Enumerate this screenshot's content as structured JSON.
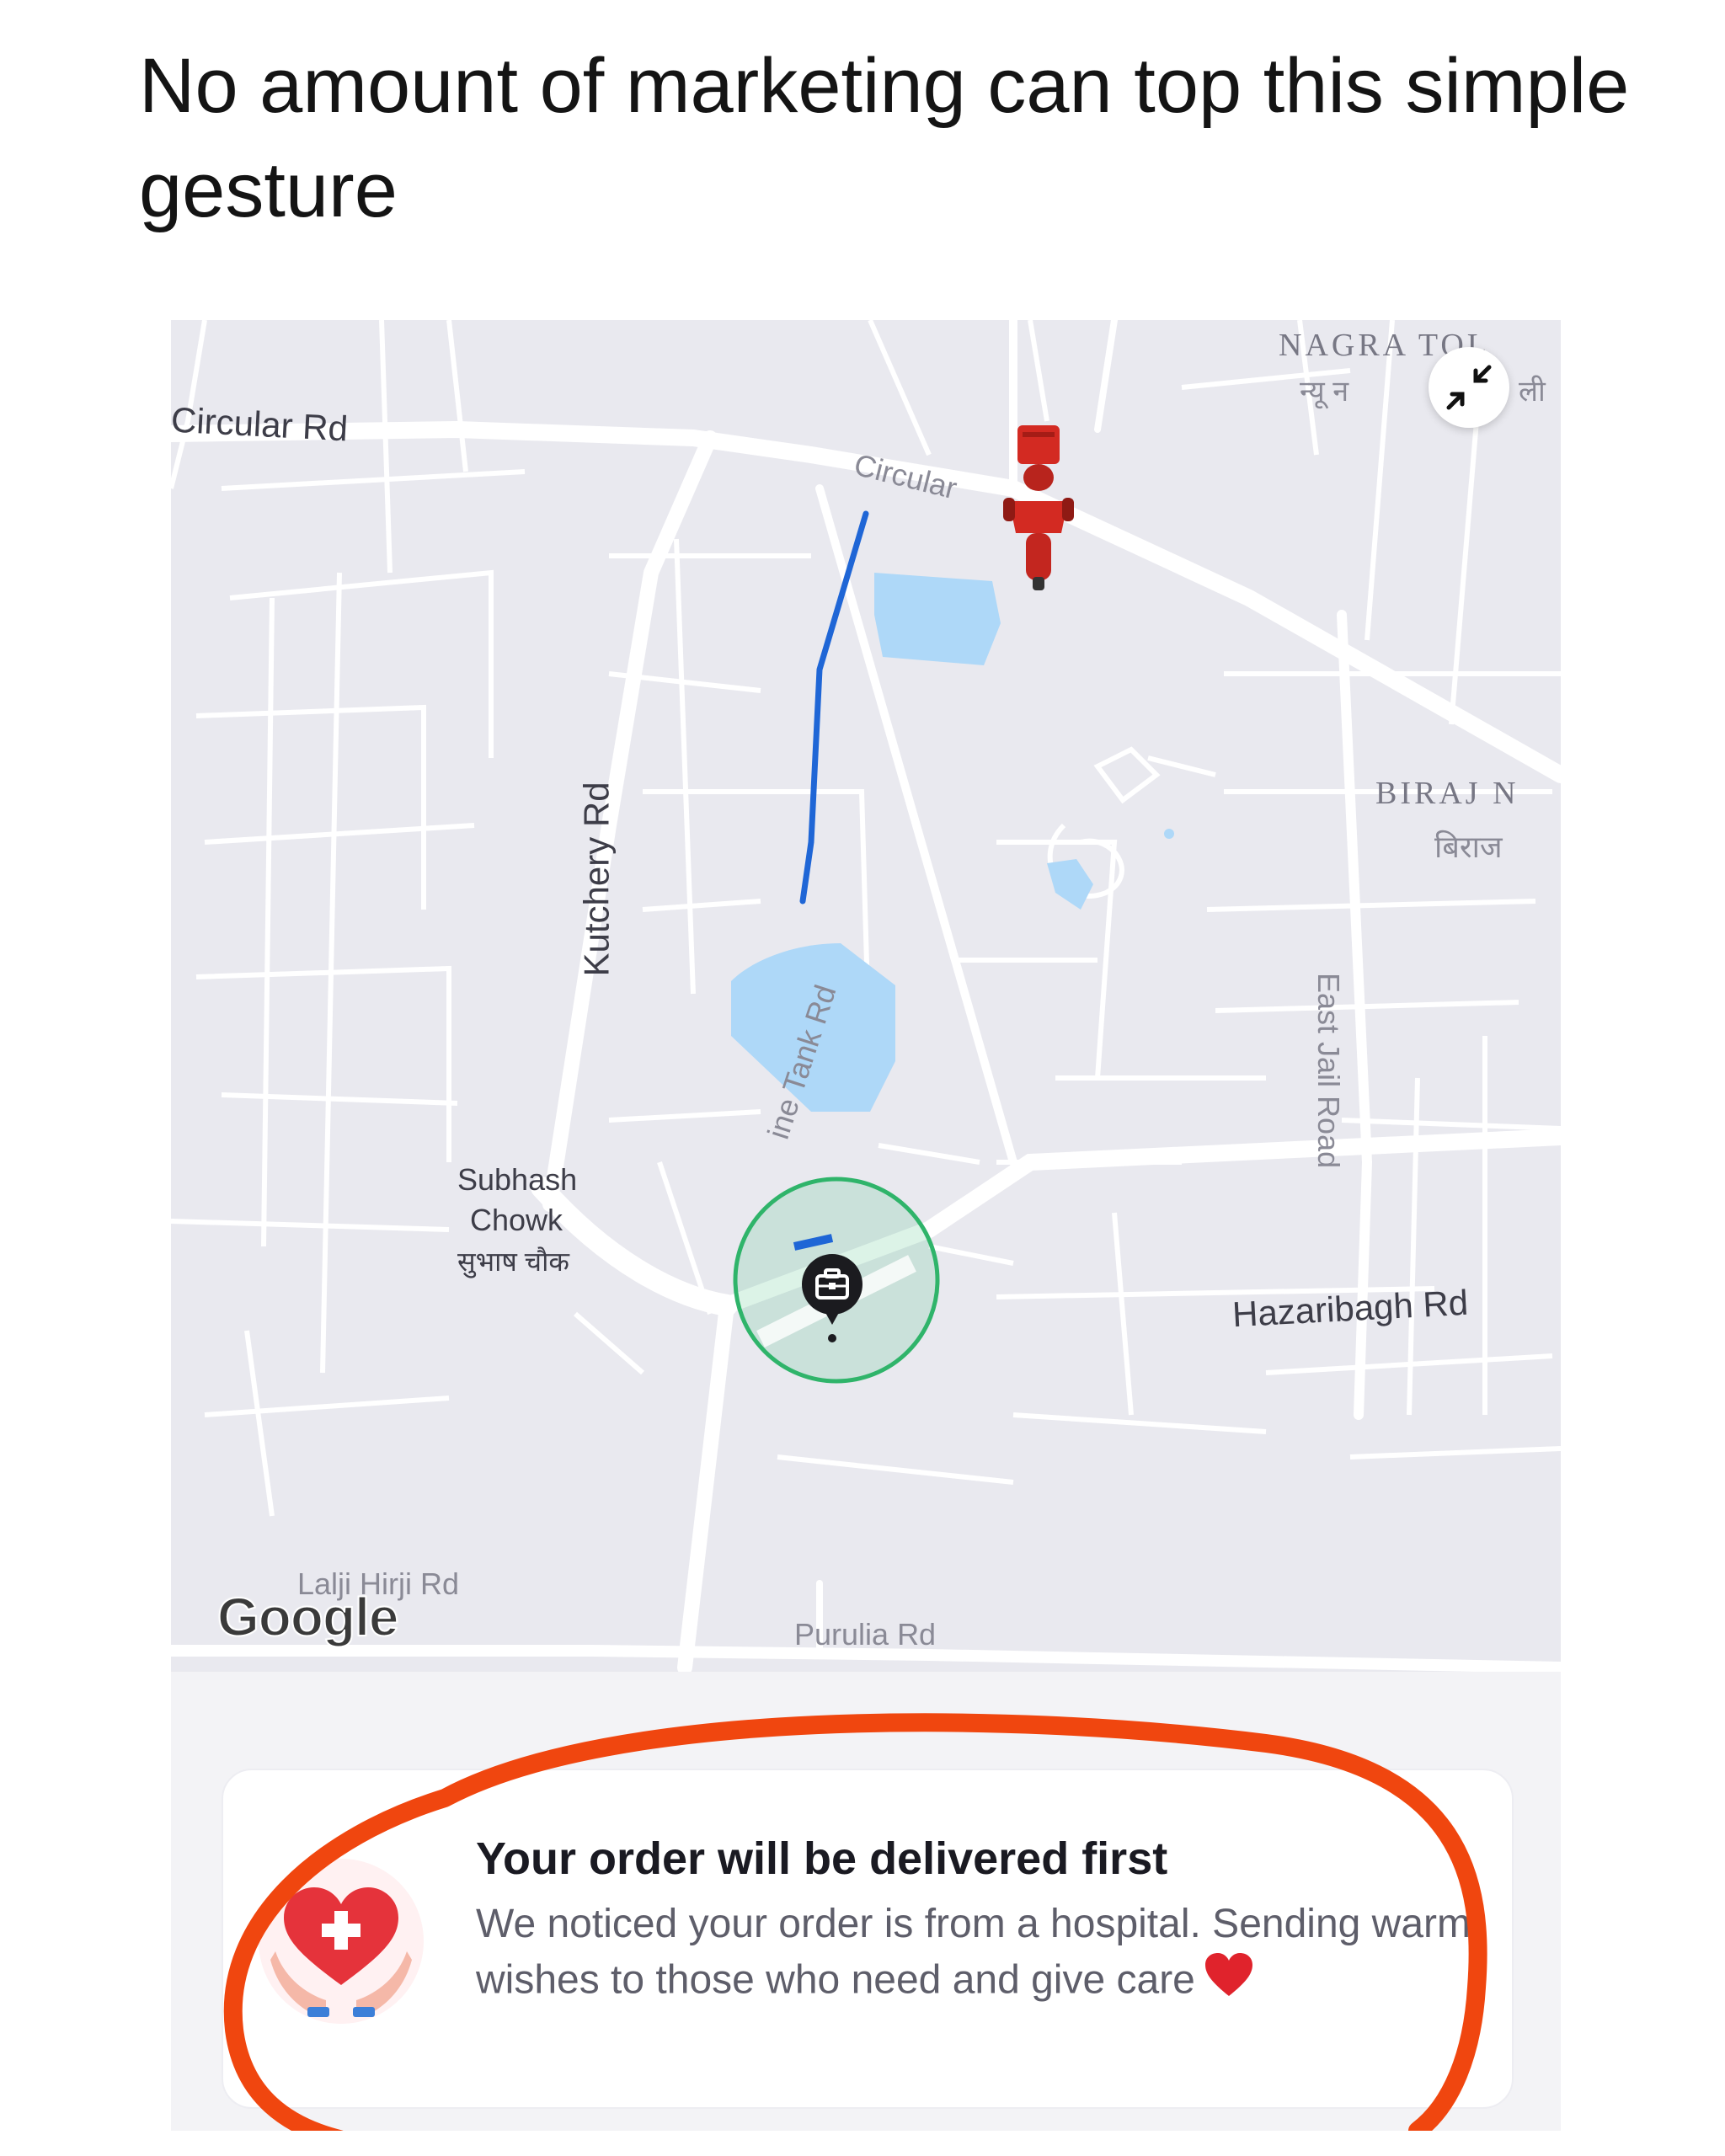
{
  "post": {
    "caption": "No amount of marketing can top this simple gesture"
  },
  "map": {
    "labels": {
      "circular_rd_left": "Circular Rd",
      "circular_rd_top": "Circular",
      "kutchery_rd": "Kutchery Rd",
      "subhash_chowk_1": "Subhash",
      "subhash_chowk_2": "Chowk",
      "subhash_chowk_hi": "सुभाष चौक",
      "tank_rd": "ine Tank Rd",
      "east_jail_road": "East Jail Road",
      "hazaribagh_rd": "Hazaribagh Rd",
      "purulia_rd": "Purulia Rd",
      "lalji_hirji_rd": "Lalji Hirji Rd",
      "nagra_tol": "NAGRA TOL",
      "nagra_tol_hi": "न्यू न",
      "nagra_tol_hi2": "ली",
      "biraj": "BIRAJ N",
      "biraj_hi": "बिराज"
    },
    "attribution": "Google",
    "colors": {
      "route": "#1f66d6",
      "water": "#aed8f8",
      "geofence": "#2fb46a",
      "rider": "#d32a22",
      "annotation": "#f0460f"
    },
    "icons": {
      "compress": "arrows-compress-icon",
      "rider": "delivery-rider-icon",
      "destination": "briefcase-pin-icon"
    }
  },
  "notice": {
    "title": "Your order will be delivered first",
    "body": "We noticed your order is from a hospital. Sending warm wishes to those who need and give care",
    "icon": "heart-in-hands-icon",
    "inline_icon": "red-heart-icon"
  }
}
